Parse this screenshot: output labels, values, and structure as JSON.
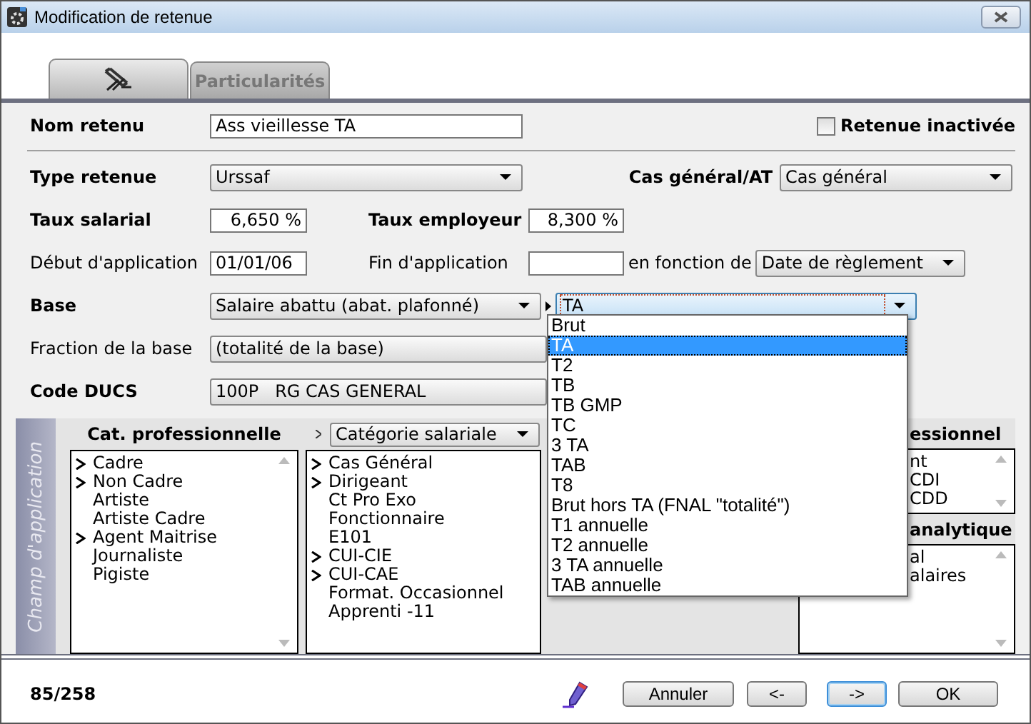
{
  "window": {
    "title": "Modification de retenue"
  },
  "tabs": [
    {
      "kind": "icon",
      "selected": true
    },
    {
      "kind": "text",
      "label": "Particularités",
      "selected": false
    }
  ],
  "form": {
    "nom_retenue": {
      "label": "Nom retenu",
      "bold": true,
      "value": "Ass vieillesse TA"
    },
    "retenue_inactivee": {
      "label": "Retenue inactivée",
      "checked": false
    },
    "type_retenue": {
      "label": "Type retenue",
      "bold": true,
      "value": "Urssaf"
    },
    "cas_general": {
      "label": "Cas général/AT",
      "bold": true,
      "value": "Cas général"
    },
    "taux_salarial": {
      "label": "Taux salarial",
      "bold": true,
      "value": "6,650 %"
    },
    "taux_employeur": {
      "label": "Taux employeur",
      "bold": true,
      "value": "8,300 %"
    },
    "debut_application": {
      "label": "Début d'application",
      "bold": false,
      "value": "01/01/06"
    },
    "fin_application": {
      "label": "Fin d'application",
      "bold": false
    },
    "en_fonction_de": {
      "label": "en fonction de",
      "bold": false,
      "value": "Date de règlement"
    },
    "base": {
      "label": "Base",
      "bold": true,
      "value": "Salaire abattu (abat. plafonné)",
      "tranche": "TA"
    },
    "fraction_base": {
      "label": "Fraction de la base",
      "bold": false,
      "value": "(totalité de la base)"
    },
    "code_ducs": {
      "label": "Code DUCS",
      "bold": true,
      "value": "100P   RG CAS GENERAL"
    }
  },
  "tranche_dropdown": {
    "options": [
      {
        "label": "Brut",
        "selected": false
      },
      {
        "label": "TA",
        "selected": true
      },
      {
        "label": "T2",
        "selected": false
      },
      {
        "label": "TB",
        "selected": false
      },
      {
        "label": "TB GMP",
        "selected": false
      },
      {
        "label": "TC",
        "selected": false
      },
      {
        "label": "3 TA",
        "selected": false
      },
      {
        "label": "TAB",
        "selected": false
      },
      {
        "label": "T8",
        "selected": false
      },
      {
        "label": "Brut hors TA (FNAL \"totalité\")",
        "selected": false
      },
      {
        "label": "T1 annuelle",
        "selected": false
      },
      {
        "label": "T2 annuelle",
        "selected": false
      },
      {
        "label": "3 TA annuelle",
        "selected": false
      },
      {
        "label": "TAB annuelle",
        "selected": false
      }
    ]
  },
  "champ_application": {
    "title": "Champ d'application",
    "cat_professionnelle": {
      "heading": "Cat. professionnelle",
      "items": [
        {
          "label": "Cadre",
          "expandable": true
        },
        {
          "label": "Non Cadre",
          "expandable": true
        },
        {
          "label": "Artiste",
          "expandable": false
        },
        {
          "label": "Artiste Cadre",
          "expandable": false
        },
        {
          "label": "Agent Maitrise",
          "expandable": true
        },
        {
          "label": "Journaliste",
          "expandable": false
        },
        {
          "label": "Pigiste",
          "expandable": false
        }
      ]
    },
    "categorie_salariale": {
      "value": "Catégorie salariale",
      "items": [
        {
          "label": "Cas Général",
          "expandable": true
        },
        {
          "label": "Dirigeant",
          "expandable": true
        },
        {
          "label": "Ct Pro Exo",
          "expandable": false
        },
        {
          "label": "Fonctionnaire",
          "expandable": false
        },
        {
          "label": "E101",
          "expandable": false
        },
        {
          "label": "CUI-CIE",
          "expandable": true
        },
        {
          "label": "CUI-CAE",
          "expandable": true
        },
        {
          "label": "Format. Occasionnel",
          "expandable": false
        },
        {
          "label": "Apprenti -11",
          "expandable": false
        }
      ]
    },
    "column_3": {
      "heading": "essionnel",
      "items": [
        "nt",
        "CDI",
        "CDD"
      ]
    },
    "column_4": {
      "heading": "analytique",
      "items": [
        "al",
        "alaires"
      ]
    }
  },
  "status": {
    "record": "85/258"
  },
  "buttons": [
    {
      "label": "Annuler",
      "focused": false
    },
    {
      "label": "<-",
      "focused": false
    },
    {
      "label": "->",
      "focused": true
    },
    {
      "label": "OK",
      "focused": false
    }
  ]
}
